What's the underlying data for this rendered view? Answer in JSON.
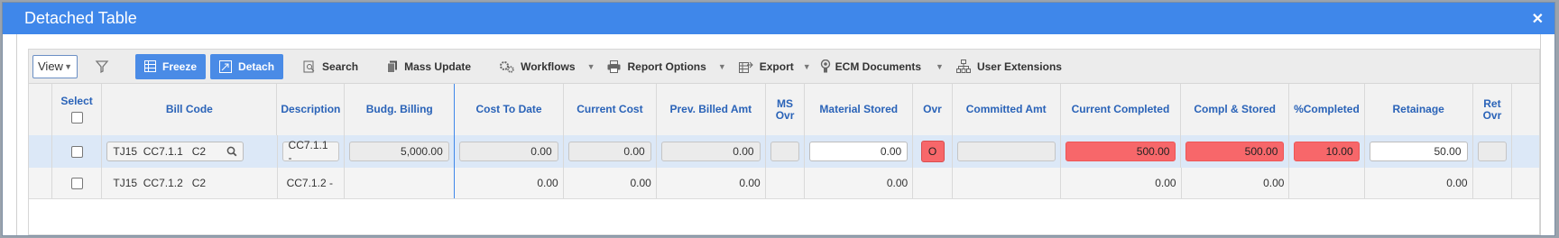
{
  "window": {
    "title": "Detached Table",
    "close": "✕"
  },
  "toolbar": {
    "view_label": "View",
    "freeze_label": "Freeze",
    "detach_label": "Detach",
    "search_label": "Search",
    "mass_update_label": "Mass Update",
    "workflows_label": "Workflows",
    "report_options_label": "Report Options",
    "export_label": "Export",
    "ecm_label": "ECM Documents",
    "user_ext_label": "User Extensions",
    "dropdown_glyph": "▼"
  },
  "columns": {
    "select": "Select",
    "bill_code": "Bill Code",
    "description": "Description",
    "budg_billing": "Budg. Billing",
    "cost_to_date": "Cost To Date",
    "current_cost": "Current Cost",
    "prev_billed": "Prev. Billed Amt",
    "ms_ovr": "MS Ovr",
    "material_stored": "Material Stored",
    "ovr": "Ovr",
    "committed_amt": "Committed Amt",
    "current_completed": "Current Completed",
    "compl_stored": "Compl & Stored",
    "pct_completed": "%Completed",
    "retainage": "Retainage",
    "ret_ovr": "Ret Ovr"
  },
  "rows": [
    {
      "bill_code": "TJ15  CC7.1.1   C2",
      "description": "CC7.1.1 -",
      "budg_billing": "5,000.00",
      "cost_to_date": "0.00",
      "current_cost": "0.00",
      "prev_billed": "0.00",
      "material_stored": "0.00",
      "ovr": "O",
      "current_completed": "500.00",
      "compl_stored": "500.00",
      "pct_completed": "10.00",
      "retainage": "50.00"
    },
    {
      "bill_code": "TJ15  CC7.1.2   C2",
      "description": "CC7.1.2 -",
      "cost_to_date": "0.00",
      "current_cost": "0.00",
      "prev_billed": "0.00",
      "material_stored": "0.00",
      "current_completed": "0.00",
      "compl_stored": "0.00",
      "retainage": "0.00"
    }
  ],
  "colors": {
    "title_bar": "#3f87ea",
    "header_text": "#2a63b8",
    "override_red": "#f7676a",
    "selected_row": "#dce8f7"
  }
}
